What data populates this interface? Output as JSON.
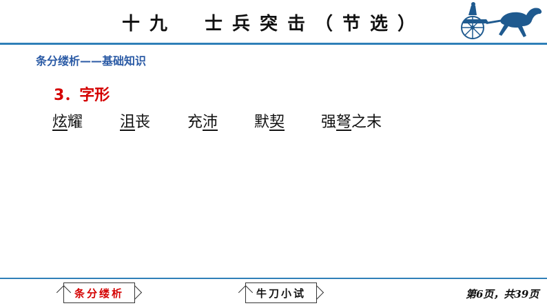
{
  "header": {
    "title": "十九　士兵突击（节选）"
  },
  "section": {
    "header": "条分缕析——基础知识",
    "subheading": "3．字形"
  },
  "words": [
    {
      "underlined": "炫",
      "rest": "耀"
    },
    {
      "underlined": "沮",
      "rest": "丧"
    },
    {
      "before": "充",
      "underlined": "沛",
      "rest": ""
    },
    {
      "before": "默",
      "underlined": "契",
      "rest": ""
    },
    {
      "before": "强",
      "underlined": "弩",
      "rest": "之末"
    }
  ],
  "footer": {
    "tab_active": "条分缕析",
    "tab_next": "牛刀小试",
    "page_counter": "第6页，共39页"
  },
  "colors": {
    "accent_blue": "#2e7fb8",
    "header_blue": "#2a5aa5",
    "highlight_red": "#d40000"
  },
  "icons": {
    "logo": "horse-chariot-icon"
  }
}
